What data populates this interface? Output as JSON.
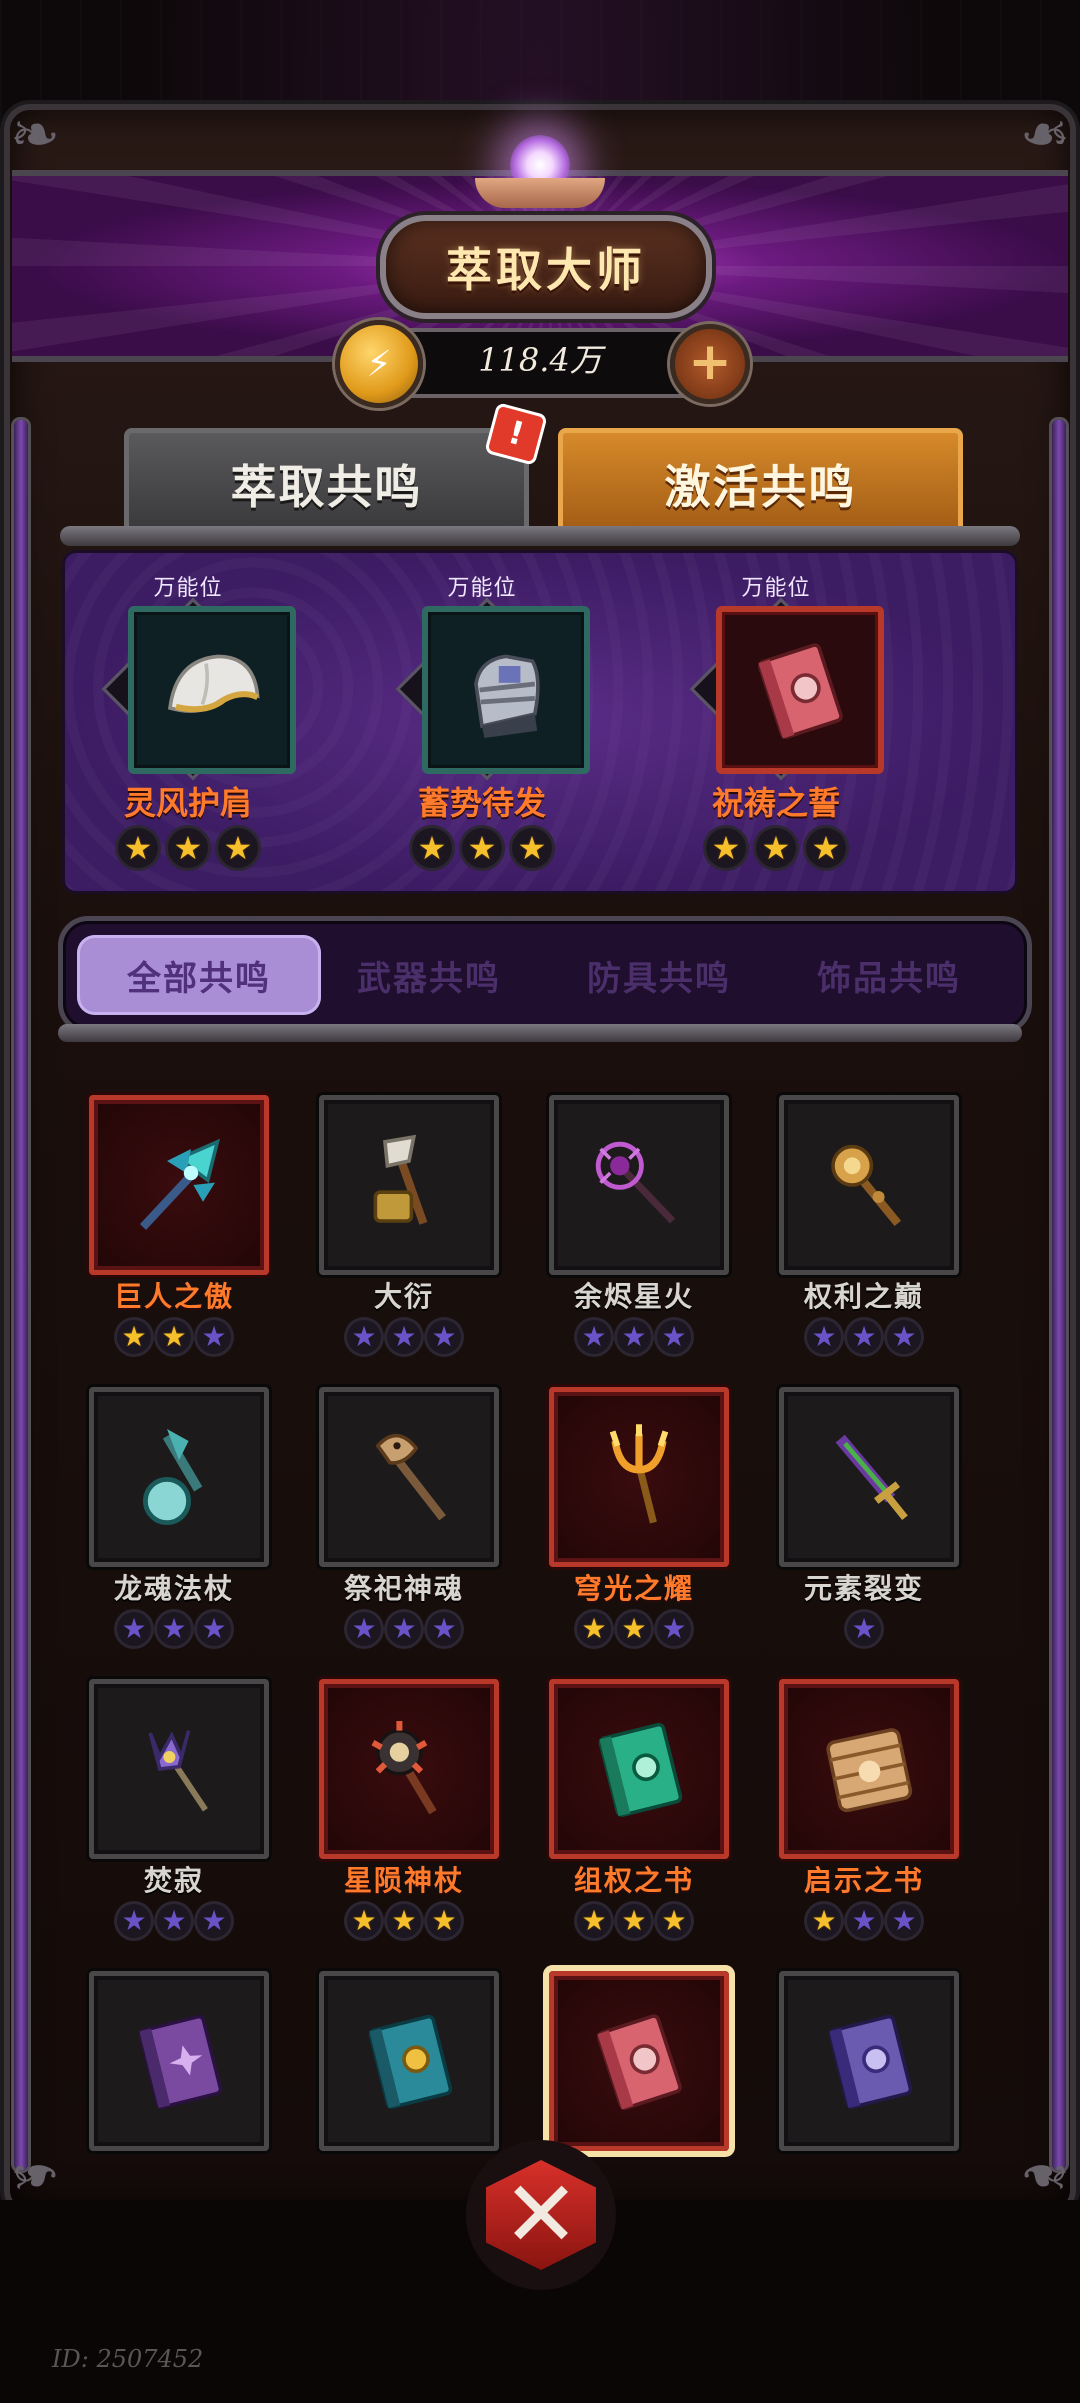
{
  "header": {
    "title": "萃取大师"
  },
  "currency": {
    "amount": "118.4万",
    "coin_icon": "lightning-coin-icon",
    "add_icon": "plus-icon"
  },
  "main_tabs": [
    {
      "label": "萃取共鸣",
      "active": false,
      "alert": "!"
    },
    {
      "label": "激活共鸣",
      "active": true
    }
  ],
  "slots": [
    {
      "label": "万能位",
      "name": "灵风护肩",
      "icon": "shoulder-armor-icon",
      "rarity": "teal",
      "stars": 3
    },
    {
      "label": "万能位",
      "name": "蓄势待发",
      "icon": "gauntlet-icon",
      "rarity": "teal",
      "stars": 3
    },
    {
      "label": "万能位",
      "name": "祝祷之誓",
      "icon": "red-book-icon",
      "rarity": "red",
      "stars": 3
    }
  ],
  "filter_tabs": [
    "全部共鸣",
    "武器共鸣",
    "防具共鸣",
    "饰品共鸣"
  ],
  "active_filter": 0,
  "items": [
    {
      "name": "巨人之傲",
      "rarity": "red",
      "icon": "crystal-spear-icon",
      "gold": 2,
      "total": 3
    },
    {
      "name": "大衍",
      "rarity": "gray",
      "icon": "axe-hammer-icon",
      "gold": 0,
      "total": 3
    },
    {
      "name": "余烬星火",
      "rarity": "gray",
      "icon": "dark-staff-icon",
      "gold": 0,
      "total": 3
    },
    {
      "name": "权利之巅",
      "rarity": "gray",
      "icon": "golden-scepter-icon",
      "gold": 0,
      "total": 3
    },
    {
      "name": "龙魂法杖",
      "rarity": "gray",
      "icon": "orb-staff-icon",
      "gold": 0,
      "total": 3
    },
    {
      "name": "祭祀神魂",
      "rarity": "gray",
      "icon": "bird-staff-icon",
      "gold": 0,
      "total": 3
    },
    {
      "name": "穹光之耀",
      "rarity": "red",
      "icon": "fire-trident-icon",
      "gold": 2,
      "total": 3
    },
    {
      "name": "元素裂变",
      "rarity": "gray",
      "icon": "rainbow-sword-icon",
      "gold": 0,
      "total": 1
    },
    {
      "name": "焚寂",
      "rarity": "gray",
      "icon": "crown-scepter-icon",
      "gold": 0,
      "total": 3
    },
    {
      "name": "星陨神杖",
      "rarity": "red",
      "icon": "spiked-mace-icon",
      "gold": 3,
      "total": 3
    },
    {
      "name": "组权之书",
      "rarity": "red",
      "icon": "green-book-icon",
      "gold": 3,
      "total": 3
    },
    {
      "name": "启示之书",
      "rarity": "red",
      "icon": "scroll-book-icon",
      "gold": 1,
      "total": 3
    },
    {
      "name": "",
      "rarity": "gray",
      "icon": "purple-book-icon",
      "gold": 0,
      "total": 0
    },
    {
      "name": "",
      "rarity": "gray",
      "icon": "teal-book-icon",
      "gold": 0,
      "total": 0
    },
    {
      "name": "",
      "rarity": "red",
      "icon": "red-book-icon",
      "gold": 0,
      "total": 0,
      "selected": true
    },
    {
      "name": "",
      "rarity": "gray",
      "icon": "violet-book-icon",
      "gold": 0,
      "total": 0
    }
  ],
  "close_icon": "close-x-icon",
  "footer": {
    "user_id": "ID: 2507452"
  }
}
